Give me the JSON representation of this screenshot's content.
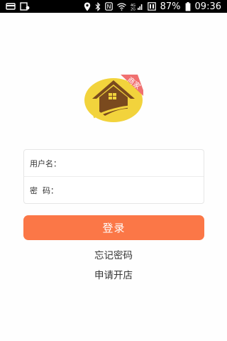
{
  "status_bar": {
    "battery_percent": "87%",
    "time": "09:36",
    "network_label": "4G"
  },
  "logo": {
    "ribbon_text": "商家",
    "brand_color": "#f2d33c",
    "roof_color": "#7a4a1e",
    "ribbon_color": "#f07070"
  },
  "form": {
    "username_label": "用户名：",
    "password_label": "密  码：",
    "username_value": "",
    "password_value": ""
  },
  "actions": {
    "login_label": "登录",
    "forgot_password_label": "忘记密码",
    "apply_store_label": "申请开店"
  },
  "colors": {
    "accent": "#fb7747"
  }
}
